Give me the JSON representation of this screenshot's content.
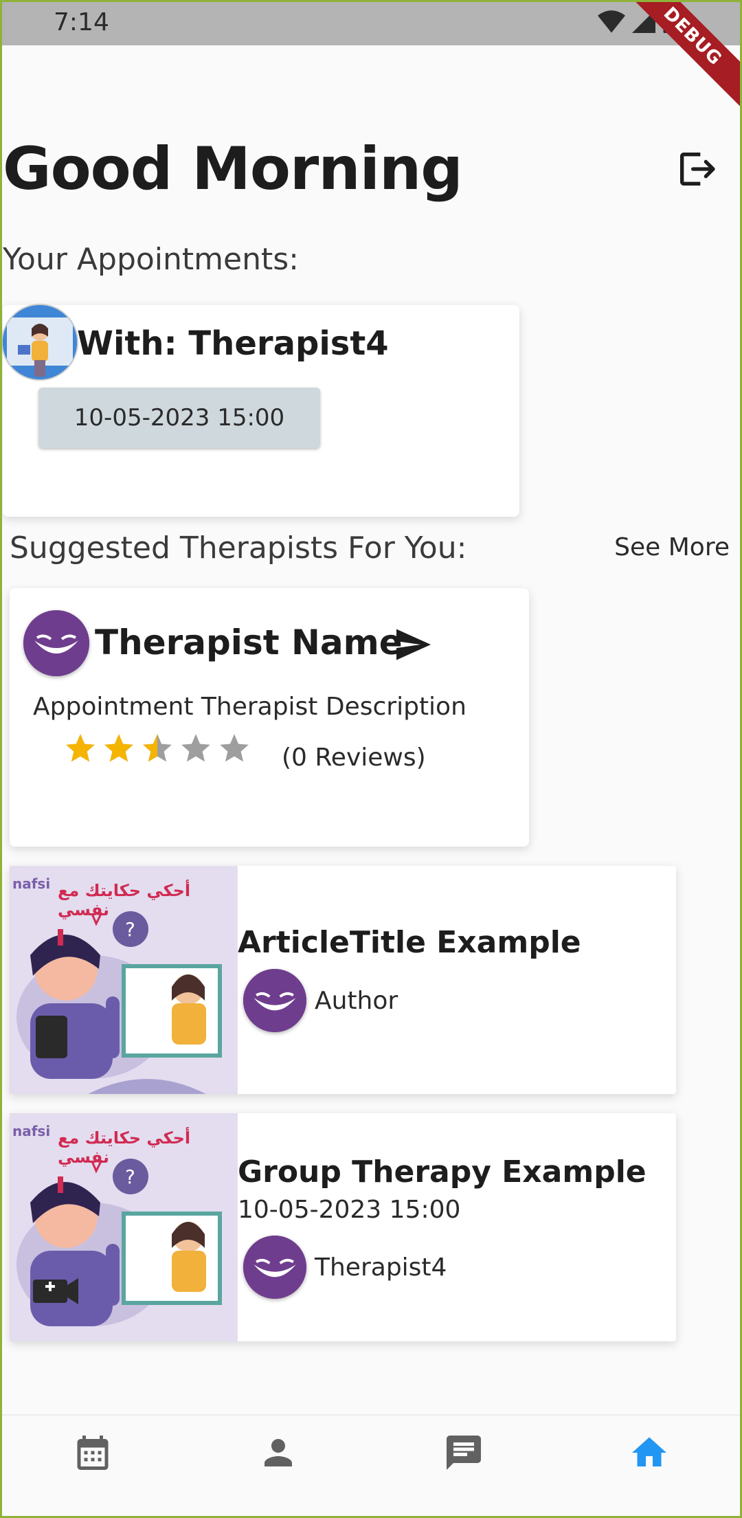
{
  "status_bar": {
    "time": "7:14",
    "debug_label": "DEBUG"
  },
  "header": {
    "greeting": "Good Morning",
    "logout_icon": "logout-icon"
  },
  "appointments": {
    "heading": "Your Appointments:",
    "items": [
      {
        "with_label": "With: Therapist4",
        "datetime": "10-05-2023 15:00"
      }
    ]
  },
  "suggested": {
    "heading": "Suggested Therapists For You:",
    "see_more": "See More",
    "therapist": {
      "name": "Therapist Name",
      "description": "Appointment Therapist Description",
      "rating": 2.5,
      "rating_max": 5,
      "reviews": "(0 Reviews)"
    }
  },
  "article": {
    "thumbnail_logo": "nafsi",
    "thumbnail_text": "أحكي حكايتك مع نفسي",
    "title": "ArticleTitle Example",
    "author": "Author"
  },
  "group_therapy": {
    "thumbnail_logo": "nafsi",
    "thumbnail_text": "أحكي حكايتك مع نفسي",
    "title": "Group Therapy Example",
    "datetime": "10-05-2023 15:00",
    "host": "Therapist4"
  },
  "bottom_nav": {
    "items": [
      {
        "icon": "calendar-icon",
        "active": false
      },
      {
        "icon": "person-icon",
        "active": false
      },
      {
        "icon": "chat-icon",
        "active": false
      },
      {
        "icon": "home-icon",
        "active": true
      }
    ]
  },
  "colors": {
    "accent": "#2196f3",
    "star": "#f5b400",
    "star_empty": "#9e9e9e",
    "avatar_purple": "#6f3d8e",
    "chip_bg": "#cfd8dd"
  }
}
